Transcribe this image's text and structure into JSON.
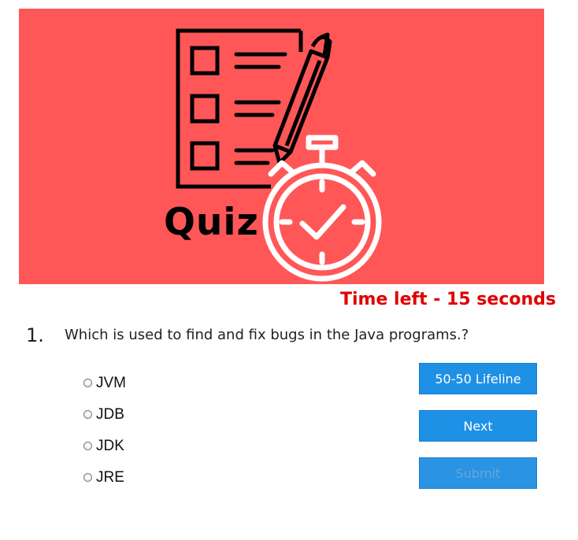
{
  "banner": {
    "title": "Quiz",
    "background_color": "#ff5757",
    "icons": [
      "checklist-icon",
      "pen-icon",
      "stopwatch-icon"
    ]
  },
  "timer": {
    "text": "Time left - 15 seconds",
    "color": "#e00000"
  },
  "question": {
    "number": "1.",
    "text": "Which is used to find and fix bugs in the Java programs.?"
  },
  "options": [
    {
      "label": "JVM",
      "selected": false
    },
    {
      "label": "JDB",
      "selected": false
    },
    {
      "label": "JDK",
      "selected": false
    },
    {
      "label": "JRE",
      "selected": false
    }
  ],
  "buttons": {
    "lifeline_label": "50-50 Lifeline",
    "next_label": "Next",
    "submit_label": "Submit",
    "submit_disabled": true,
    "color": "#1e90e6"
  }
}
